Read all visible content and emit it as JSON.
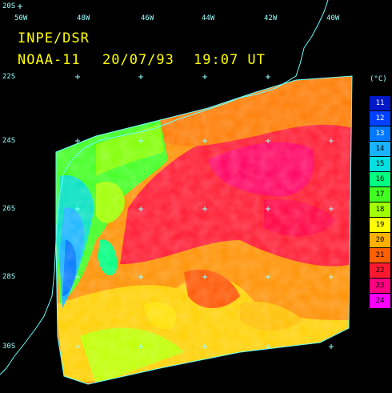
{
  "header": {
    "agency": "INPE/DSR",
    "satellite": "NOAA-11",
    "date": "20/07/93",
    "time": "19:07 UT"
  },
  "grid": {
    "longitudes": [
      "50W",
      "48W",
      "46W",
      "44W",
      "42W",
      "40W"
    ],
    "latitudes": [
      "22S",
      "24S",
      "26S",
      "28S",
      "30S"
    ],
    "corner_lat": "20S"
  },
  "legend": {
    "unit": "(°C)",
    "entries": [
      {
        "value": "11",
        "color": "#0018c8"
      },
      {
        "value": "12",
        "color": "#0040ff"
      },
      {
        "value": "13",
        "color": "#0078ff"
      },
      {
        "value": "14",
        "color": "#18b4ff"
      },
      {
        "value": "15",
        "color": "#00e0e0"
      },
      {
        "value": "16",
        "color": "#00ff80"
      },
      {
        "value": "17",
        "color": "#40ff20"
      },
      {
        "value": "18",
        "color": "#a0ff00"
      },
      {
        "value": "19",
        "color": "#ffff00"
      },
      {
        "value": "20",
        "color": "#ffb000"
      },
      {
        "value": "21",
        "color": "#ff6000"
      },
      {
        "value": "22",
        "color": "#ff1830"
      },
      {
        "value": "23",
        "color": "#ff0080"
      },
      {
        "value": "24",
        "color": "#ff00ff"
      }
    ]
  },
  "colors": {
    "background": "#000000",
    "grid": "#99ffff",
    "header_text": "#ffff00",
    "coastline": "#66ffff"
  }
}
